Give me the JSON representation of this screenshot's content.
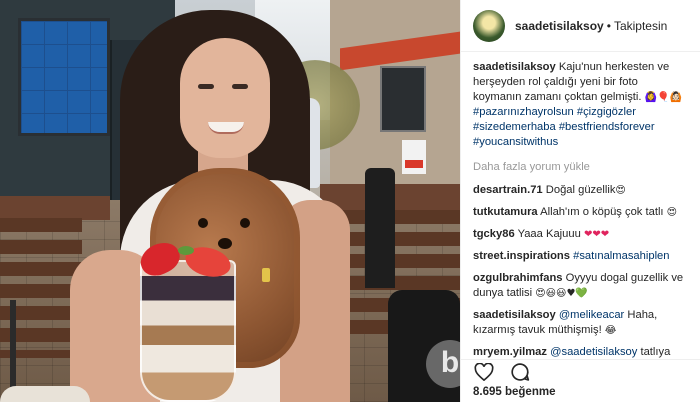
{
  "header": {
    "username": "saadetisilaksoy",
    "separator": "•",
    "follow_status": "Takiptesin"
  },
  "caption": {
    "username": "saadetisilaksoy",
    "text": " Kaju'nun herkesten ve herşeyden rol çaldığı yeni bir foto koymanın zamanı çoktan gelmişti. ",
    "emojis": "🙆‍♀️🎈🙆🏻",
    "hashtags": [
      "#pazarınızhayrolsun",
      "#çizgigözler",
      "#sizedemerhaba",
      "#bestfriendsforever",
      "#youcansitwithus"
    ]
  },
  "load_more": "Daha fazla yorum yükle",
  "comments": [
    {
      "user": "desartrain.71",
      "text": " Doğal güzellik",
      "emoji": "😍"
    },
    {
      "user": "tutkutamura",
      "text": " Allah'ım o köpüş çok tatlı ",
      "emoji": "😍"
    },
    {
      "user": "tgcky86",
      "text": " Yaaa Kajuuu ",
      "emoji": "❤❤❤"
    },
    {
      "user": "street.inspirations",
      "text": " ",
      "link": "#satınalmasahiplen"
    },
    {
      "user": "ozgulbrahimfans",
      "text": " Oyyyu dogal guzellik ve dunya tatlisi ",
      "emoji": "😍😃😃♥💚"
    },
    {
      "user": "saadetisilaksoy",
      "text": " Haha, kızarmış tavuk müthişmiş! ",
      "link": "@melikeacar",
      "emoji": "😂"
    },
    {
      "user": "mryem.yilmaz",
      "text": " tatlıya dondurmaya tercih edilebilinecek Yenilesi",
      "link": "@saadetisilaksoy"
    }
  ],
  "actions": {
    "like_icon": "heart-icon",
    "comment_icon": "speech-bubble-icon"
  },
  "likes": "8.695 beğenme",
  "watermark": "b"
}
